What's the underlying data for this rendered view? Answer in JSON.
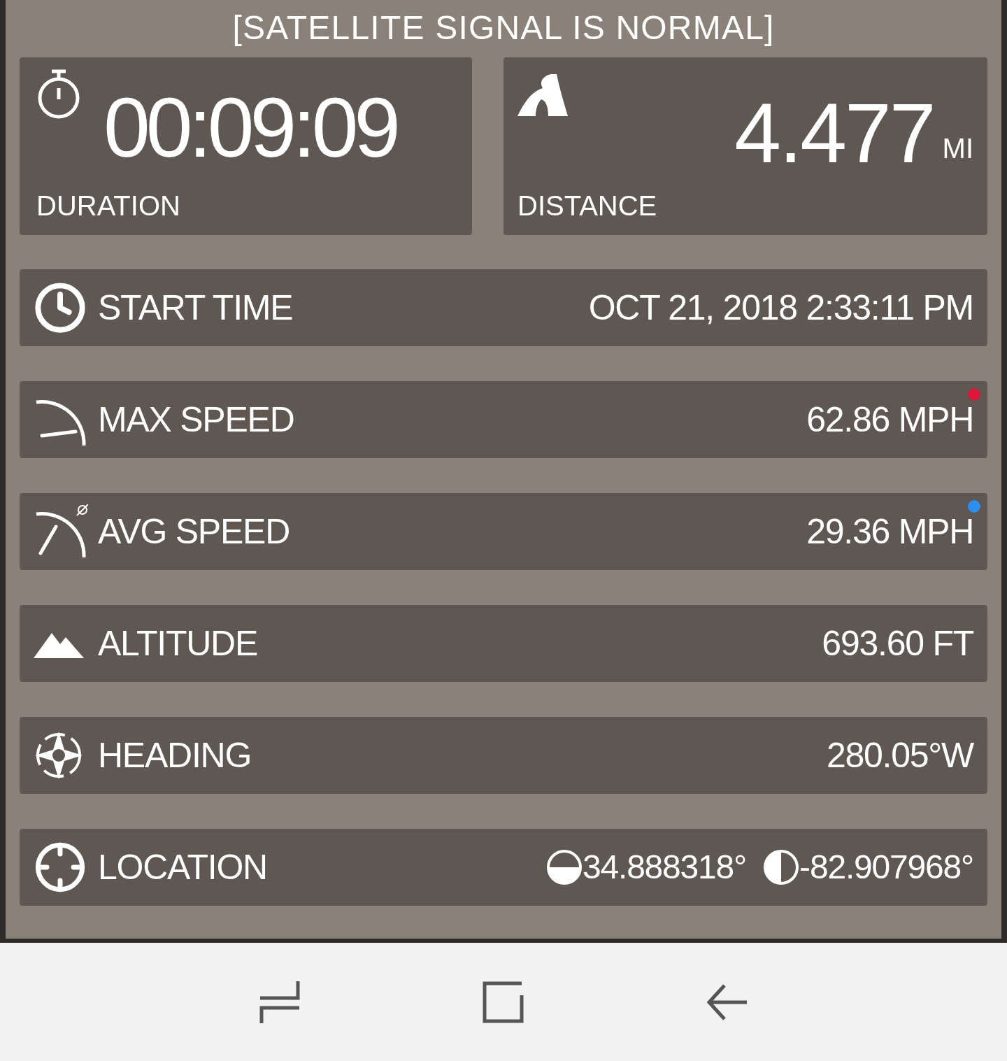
{
  "status": "[SATELLITE SIGNAL IS NORMAL]",
  "tiles": [
    {
      "kind": "duration",
      "label": "DURATION",
      "value": "00:09:09"
    },
    {
      "kind": "distance",
      "label": "DISTANCE",
      "value": "4.477",
      "unit": "MI"
    }
  ],
  "rows": [
    {
      "kind": "start",
      "label": "START TIME",
      "value": "OCT 21, 2018 2:33:11 PM"
    },
    {
      "kind": "max",
      "label": "MAX SPEED",
      "value": "62.86 MPH",
      "color": "#d8173a"
    },
    {
      "kind": "avg",
      "label": "AVG SPEED",
      "value": "29.36 MPH",
      "color": "#2e8ef0"
    },
    {
      "kind": "altitude",
      "label": "ALTITUDE",
      "value": "693.60 FT"
    },
    {
      "kind": "heading",
      "label": "HEADING",
      "value": "280.05°W"
    },
    {
      "kind": "location",
      "label": "LOCATION",
      "values": [
        "34.888318°",
        "-82.907968°"
      ]
    }
  ]
}
